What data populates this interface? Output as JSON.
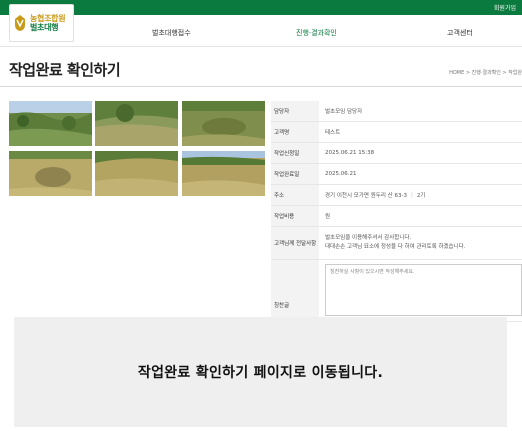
{
  "header": {
    "top_link": "회원가입",
    "logo": {
      "line1": "농협조합원",
      "line2": "벌초대행"
    },
    "nav": [
      {
        "label": "벌초대행접수"
      },
      {
        "label": "진행·결과확인"
      },
      {
        "label": "고객센터"
      }
    ]
  },
  "page": {
    "title": "작업완료 확인하기",
    "breadcrumb": "HOME > 진행·결과확인 > 작업완"
  },
  "photos": [
    {
      "alt": "photo-1"
    },
    {
      "alt": "photo-2"
    },
    {
      "alt": "photo-3"
    },
    {
      "alt": "photo-4"
    },
    {
      "alt": "photo-5"
    },
    {
      "alt": "photo-6"
    }
  ],
  "details": {
    "manager": {
      "label": "담당자",
      "value": "벌초모임 담당자"
    },
    "customer": {
      "label": "고객명",
      "value": "테스트"
    },
    "request_date": {
      "label": "작업신청일",
      "value": "2025.06.21 15:38"
    },
    "complete_date": {
      "label": "작업완료일",
      "value": "2025.06.21"
    },
    "address": {
      "label": "주소",
      "value": "경기 이천시 모가면 원두리 산 63-3",
      "count": "2기"
    },
    "cost": {
      "label": "작업비용",
      "value": "원"
    },
    "message": {
      "label": "고객님께 전달사항",
      "line1": "벌초모임을 이용해주셔서 감사합니다.",
      "line2": "대대손손 고객님 묘소에 정성을 다 하여 관리토록 하겠습니다."
    },
    "memo": {
      "label": "칭찬글",
      "placeholder": "칭찬하실 사항이 있으시면 작성해주세요."
    }
  },
  "overlay": {
    "message": "작업완료 확인하기 페이지로 이동됩니다."
  },
  "colors": {
    "brand_green": "#0b7a3e",
    "brand_gold": "#c89a18"
  }
}
